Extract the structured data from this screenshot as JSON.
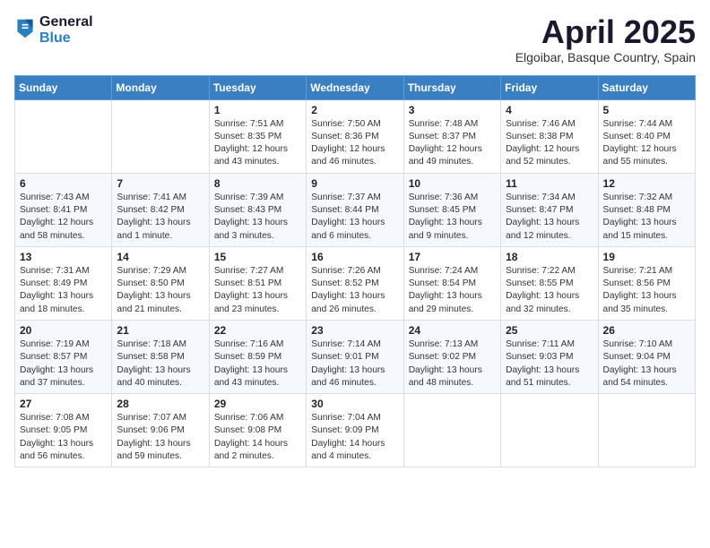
{
  "logo": {
    "general": "General",
    "blue": "Blue"
  },
  "title": "April 2025",
  "subtitle": "Elgoibar, Basque Country, Spain",
  "weekdays": [
    "Sunday",
    "Monday",
    "Tuesday",
    "Wednesday",
    "Thursday",
    "Friday",
    "Saturday"
  ],
  "weeks": [
    [
      {
        "day": "",
        "info": ""
      },
      {
        "day": "",
        "info": ""
      },
      {
        "day": "1",
        "info": "Sunrise: 7:51 AM\nSunset: 8:35 PM\nDaylight: 12 hours and 43 minutes."
      },
      {
        "day": "2",
        "info": "Sunrise: 7:50 AM\nSunset: 8:36 PM\nDaylight: 12 hours and 46 minutes."
      },
      {
        "day": "3",
        "info": "Sunrise: 7:48 AM\nSunset: 8:37 PM\nDaylight: 12 hours and 49 minutes."
      },
      {
        "day": "4",
        "info": "Sunrise: 7:46 AM\nSunset: 8:38 PM\nDaylight: 12 hours and 52 minutes."
      },
      {
        "day": "5",
        "info": "Sunrise: 7:44 AM\nSunset: 8:40 PM\nDaylight: 12 hours and 55 minutes."
      }
    ],
    [
      {
        "day": "6",
        "info": "Sunrise: 7:43 AM\nSunset: 8:41 PM\nDaylight: 12 hours and 58 minutes."
      },
      {
        "day": "7",
        "info": "Sunrise: 7:41 AM\nSunset: 8:42 PM\nDaylight: 13 hours and 1 minute."
      },
      {
        "day": "8",
        "info": "Sunrise: 7:39 AM\nSunset: 8:43 PM\nDaylight: 13 hours and 3 minutes."
      },
      {
        "day": "9",
        "info": "Sunrise: 7:37 AM\nSunset: 8:44 PM\nDaylight: 13 hours and 6 minutes."
      },
      {
        "day": "10",
        "info": "Sunrise: 7:36 AM\nSunset: 8:45 PM\nDaylight: 13 hours and 9 minutes."
      },
      {
        "day": "11",
        "info": "Sunrise: 7:34 AM\nSunset: 8:47 PM\nDaylight: 13 hours and 12 minutes."
      },
      {
        "day": "12",
        "info": "Sunrise: 7:32 AM\nSunset: 8:48 PM\nDaylight: 13 hours and 15 minutes."
      }
    ],
    [
      {
        "day": "13",
        "info": "Sunrise: 7:31 AM\nSunset: 8:49 PM\nDaylight: 13 hours and 18 minutes."
      },
      {
        "day": "14",
        "info": "Sunrise: 7:29 AM\nSunset: 8:50 PM\nDaylight: 13 hours and 21 minutes."
      },
      {
        "day": "15",
        "info": "Sunrise: 7:27 AM\nSunset: 8:51 PM\nDaylight: 13 hours and 23 minutes."
      },
      {
        "day": "16",
        "info": "Sunrise: 7:26 AM\nSunset: 8:52 PM\nDaylight: 13 hours and 26 minutes."
      },
      {
        "day": "17",
        "info": "Sunrise: 7:24 AM\nSunset: 8:54 PM\nDaylight: 13 hours and 29 minutes."
      },
      {
        "day": "18",
        "info": "Sunrise: 7:22 AM\nSunset: 8:55 PM\nDaylight: 13 hours and 32 minutes."
      },
      {
        "day": "19",
        "info": "Sunrise: 7:21 AM\nSunset: 8:56 PM\nDaylight: 13 hours and 35 minutes."
      }
    ],
    [
      {
        "day": "20",
        "info": "Sunrise: 7:19 AM\nSunset: 8:57 PM\nDaylight: 13 hours and 37 minutes."
      },
      {
        "day": "21",
        "info": "Sunrise: 7:18 AM\nSunset: 8:58 PM\nDaylight: 13 hours and 40 minutes."
      },
      {
        "day": "22",
        "info": "Sunrise: 7:16 AM\nSunset: 8:59 PM\nDaylight: 13 hours and 43 minutes."
      },
      {
        "day": "23",
        "info": "Sunrise: 7:14 AM\nSunset: 9:01 PM\nDaylight: 13 hours and 46 minutes."
      },
      {
        "day": "24",
        "info": "Sunrise: 7:13 AM\nSunset: 9:02 PM\nDaylight: 13 hours and 48 minutes."
      },
      {
        "day": "25",
        "info": "Sunrise: 7:11 AM\nSunset: 9:03 PM\nDaylight: 13 hours and 51 minutes."
      },
      {
        "day": "26",
        "info": "Sunrise: 7:10 AM\nSunset: 9:04 PM\nDaylight: 13 hours and 54 minutes."
      }
    ],
    [
      {
        "day": "27",
        "info": "Sunrise: 7:08 AM\nSunset: 9:05 PM\nDaylight: 13 hours and 56 minutes."
      },
      {
        "day": "28",
        "info": "Sunrise: 7:07 AM\nSunset: 9:06 PM\nDaylight: 13 hours and 59 minutes."
      },
      {
        "day": "29",
        "info": "Sunrise: 7:06 AM\nSunset: 9:08 PM\nDaylight: 14 hours and 2 minutes."
      },
      {
        "day": "30",
        "info": "Sunrise: 7:04 AM\nSunset: 9:09 PM\nDaylight: 14 hours and 4 minutes."
      },
      {
        "day": "",
        "info": ""
      },
      {
        "day": "",
        "info": ""
      },
      {
        "day": "",
        "info": ""
      }
    ]
  ]
}
